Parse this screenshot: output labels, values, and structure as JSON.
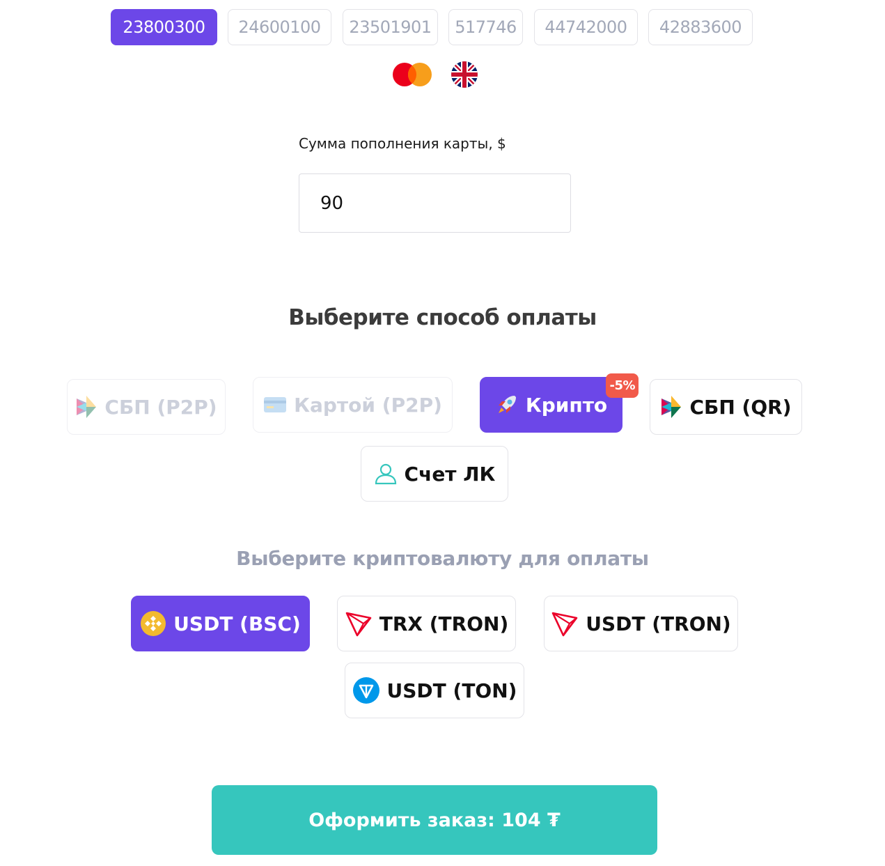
{
  "bins": [
    "23800300",
    "24600100",
    "23501901",
    "517746",
    "44742000",
    "42883600"
  ],
  "card_icons": [
    "mastercard-icon",
    "uk-flag-icon"
  ],
  "amount": {
    "label": "Сумма пополнения карты, $",
    "value": "90"
  },
  "payment": {
    "title": "Выберите способ оплаты",
    "methods": {
      "sbp_p2p": "СБП (P2P)",
      "card_p2p": "Картой (P2P)",
      "crypto": "Крипто",
      "crypto_badge": "-5%",
      "sbp_qr": "СБП (QR)",
      "account": "Счет ЛК"
    }
  },
  "crypto": {
    "title": "Выберите криптовалюту для оплаты",
    "options": {
      "usdt_bsc": "USDT (BSC)",
      "trx_tron": "TRX (TRON)",
      "usdt_tron": "USDT (TRON)",
      "usdt_ton": "USDT (TON)"
    }
  },
  "submit_label": "Оформить заказ: 104 ₮",
  "colors": {
    "accent": "#6c47e8",
    "submit": "#36c6bd",
    "badge": "#f15a4a"
  }
}
